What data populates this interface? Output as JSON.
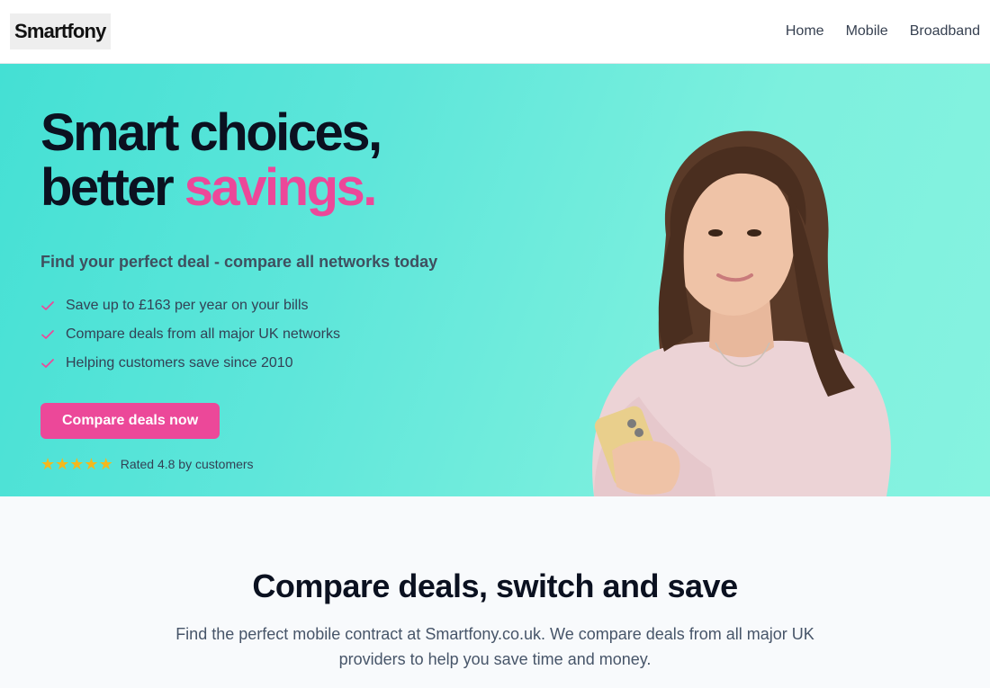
{
  "header": {
    "logo_text": "Smartfony",
    "nav": [
      "Home",
      "Mobile",
      "Broadband"
    ]
  },
  "hero": {
    "headline_line1": "Smart choices,",
    "headline_line2_prefix": "better ",
    "headline_line2_accent": "savings.",
    "subhead": "Find your perfect deal - compare all networks today",
    "benefits": [
      "Save up to £163 per year on your bills",
      "Compare deals from all major UK networks",
      "Helping customers save since 2010"
    ],
    "cta_label": "Compare deals now",
    "rating": {
      "stars": 5,
      "text": "Rated 4.8 by customers"
    },
    "image_description": "woman-holding-phone"
  },
  "section": {
    "title": "Compare deals, switch and save",
    "body": "Find the perfect mobile contract at Smartfony.co.uk. We compare deals from all major UK providers to help you save time and money."
  },
  "colors": {
    "accent": "#ec4899",
    "hero_gradient_start": "#44e0d4",
    "hero_gradient_end": "#86f3e0",
    "star": "#f5b81c",
    "check": "#ec4899"
  },
  "icons": {
    "check": "check-icon",
    "star": "star-icon"
  }
}
